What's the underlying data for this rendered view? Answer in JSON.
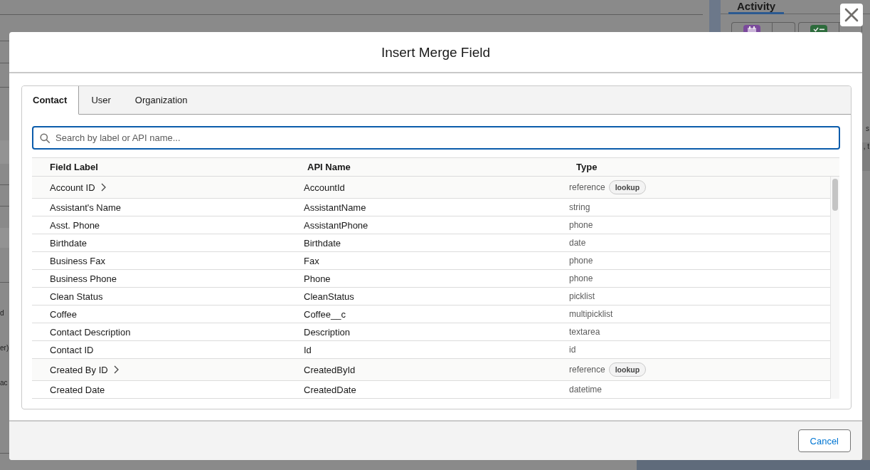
{
  "background_page": {
    "tabs": [
      {
        "label": "Activity",
        "selected": true
      }
    ],
    "left_text_fragments": [
      "d",
      "er)",
      "ac"
    ],
    "right_text_fragments": [
      "s",
      ", t"
    ]
  },
  "modal": {
    "title": "Insert Merge Field",
    "tabs": [
      {
        "label": "Contact",
        "selected": true
      },
      {
        "label": "User",
        "selected": false
      },
      {
        "label": "Organization",
        "selected": false
      }
    ],
    "search": {
      "placeholder": "Search by label or API name...",
      "focused": true
    },
    "table": {
      "columns": [
        "Field Label",
        "API Name",
        "Type"
      ],
      "rows": [
        {
          "label": "Account ID",
          "api_name": "AccountId",
          "type": "reference",
          "tag": "lookup",
          "expandable": true
        },
        {
          "label": "Assistant's Name",
          "api_name": "AssistantName",
          "type": "string",
          "expandable": false
        },
        {
          "label": "Asst. Phone",
          "api_name": "AssistantPhone",
          "type": "phone",
          "expandable": false
        },
        {
          "label": "Birthdate",
          "api_name": "Birthdate",
          "type": "date",
          "expandable": false
        },
        {
          "label": "Business Fax",
          "api_name": "Fax",
          "type": "phone",
          "expandable": false
        },
        {
          "label": "Business Phone",
          "api_name": "Phone",
          "type": "phone",
          "expandable": false
        },
        {
          "label": "Clean Status",
          "api_name": "CleanStatus",
          "type": "picklist",
          "expandable": false
        },
        {
          "label": "Coffee",
          "api_name": "Coffee__c",
          "type": "multipicklist",
          "expandable": false
        },
        {
          "label": "Contact Description",
          "api_name": "Description",
          "type": "textarea",
          "expandable": false
        },
        {
          "label": "Contact ID",
          "api_name": "Id",
          "type": "id",
          "expandable": false
        },
        {
          "label": "Created By ID",
          "api_name": "CreatedById",
          "type": "reference",
          "tag": "lookup",
          "expandable": true
        },
        {
          "label": "Created Date",
          "api_name": "CreatedDate",
          "type": "datetime",
          "expandable": false
        }
      ]
    },
    "buttons": [
      "Cancel"
    ]
  }
}
